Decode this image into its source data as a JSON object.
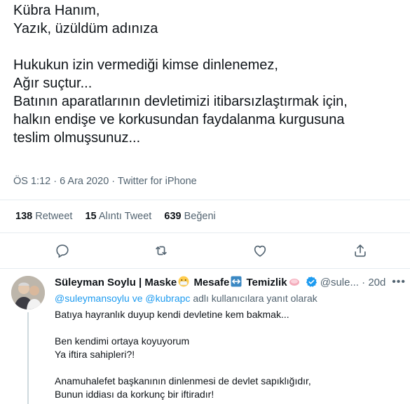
{
  "tweet": {
    "lines": [
      "Kübra Hanım,",
      "Yazık, üzüldüm adınıza",
      "",
      "Hukukun izin vermediği kimse dinlenemez,",
      "Ağır suçtur...",
      "Batının aparatlarının devletimizi itibarsızlaştırmak için,",
      "halkın endişe ve korkusundan faydalanma kurgusuna",
      "teslim olmuşsunuz..."
    ],
    "time": "ÖS 1:12",
    "separator": "·",
    "date": "6 Ara 2020",
    "source": "Twitter for iPhone"
  },
  "stats": {
    "retweets_count": "138",
    "retweets_label": "Retweet",
    "quotes_count": "15",
    "quotes_label": "Alıntı Tweet",
    "likes_count": "639",
    "likes_label": "Beğeni"
  },
  "actions": [
    "reply-icon",
    "retweet-icon",
    "like-icon",
    "share-icon"
  ],
  "reply": {
    "name_part1": "Süleyman Soylu | Maske",
    "name_part2": "Mesafe",
    "name_part3": "Temizlik",
    "handle": "@sule...",
    "separator": "·",
    "time": "20d",
    "more": "•••",
    "replying_mention1": "@suleymansoylu",
    "replying_and": "ve",
    "replying_mention2": "@kubrapc",
    "replying_suffix": "adlı kullanıcılara yanıt olarak",
    "body_lines": [
      "Batıya hayranlık duyup kendi devletine kem bakmak...",
      "",
      "Ben kendimi ortaya koyuyorum",
      "Ya iftira sahipleri?!",
      "",
      "Anamuhalefet başkanının dinlenmesi de devlet sapıklığıdır,",
      "Bunun iddiası da korkunç bir iftiradır!"
    ]
  },
  "colors": {
    "text": "#0f1419",
    "secondary": "#536471",
    "link": "#1d9bf0",
    "divider": "#e6ecf0"
  }
}
